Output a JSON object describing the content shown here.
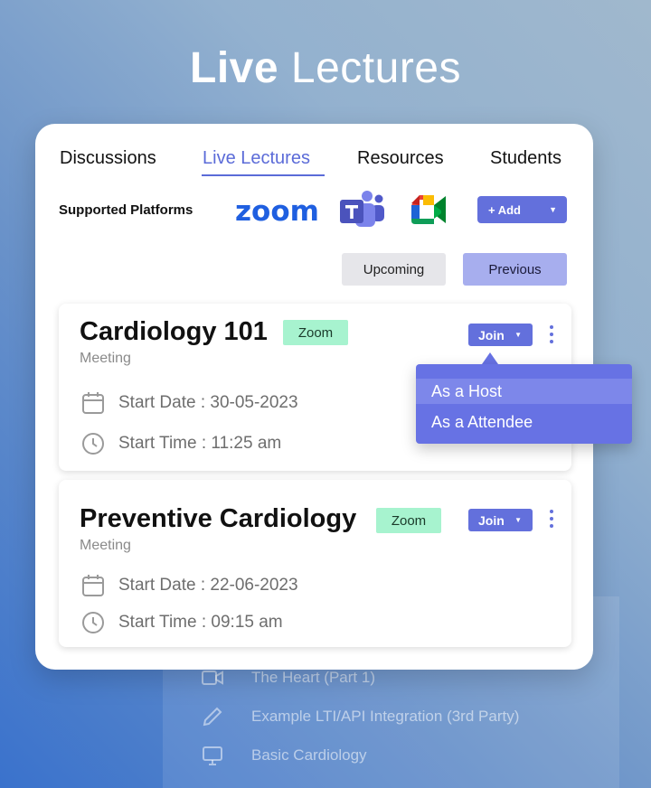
{
  "hero": {
    "title_bold": "Live",
    "title_rest": "Lectures"
  },
  "tabs": [
    {
      "label": "Discussions"
    },
    {
      "label": "Live Lectures",
      "active": true
    },
    {
      "label": "Resources"
    },
    {
      "label": "Students"
    }
  ],
  "platforms": {
    "label": "Supported Platforms",
    "zoom_logo_text": "zoom",
    "icons": [
      "zoom-logo",
      "microsoft-teams-icon",
      "google-meet-icon"
    ]
  },
  "add_button": {
    "label": "+ Add",
    "caret": "▼"
  },
  "filter": {
    "upcoming": "Upcoming",
    "previous": "Previous",
    "selected": "Previous"
  },
  "lectures": [
    {
      "title": "Cardiology 101",
      "platform": "Zoom",
      "type": "Meeting",
      "start_date": "Start Date : 30-05-2023",
      "start_time": "Start Time : 11:25 am",
      "join_label": "Join"
    },
    {
      "title": "Preventive Cardiology",
      "platform": "Zoom",
      "type": "Meeting",
      "start_date": "Start Date : 22-06-2023",
      "start_time": "Start Time : 09:15 am",
      "join_label": "Join"
    }
  ],
  "join_caret": "▼",
  "join_menu": {
    "items": [
      {
        "label": "As a Host"
      },
      {
        "label": "As a Attendee"
      }
    ],
    "hovered_index": 0
  },
  "background_list": [
    {
      "label": "The Heart (Part 1)",
      "icon": "video-camera-icon"
    },
    {
      "label": "Example LTI/API Integration (3rd Party)",
      "icon": "pencil-icon"
    },
    {
      "label": "Basic Cardiology",
      "icon": "monitor-icon"
    }
  ],
  "colors": {
    "accent": "#6370dc",
    "badge": "#a7f3cf",
    "zoom_blue": "#1f5fe0"
  }
}
